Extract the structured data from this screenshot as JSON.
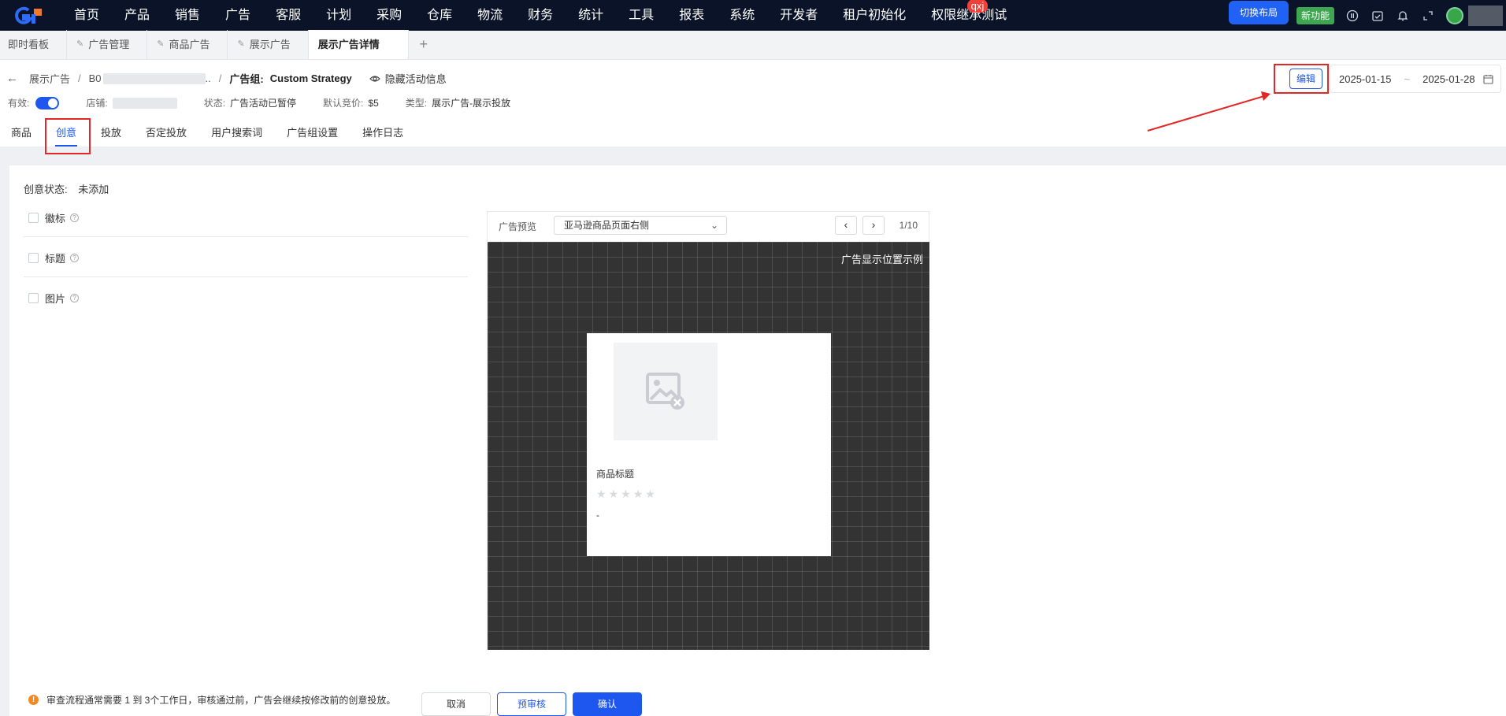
{
  "nav": {
    "items": [
      "首页",
      "产品",
      "销售",
      "广告",
      "客服",
      "计划",
      "采购",
      "仓库",
      "物流",
      "财务",
      "统计",
      "工具",
      "报表",
      "系统",
      "开发者",
      "租户初始化",
      "权限继承测试"
    ],
    "badge": "qxj",
    "switch_layout": "切换布局",
    "new_feature": "新功能"
  },
  "tabs": {
    "items": [
      "即时看板",
      "广告管理",
      "商品广告",
      "展示广告",
      "展示广告详情"
    ],
    "add": "+"
  },
  "header": {
    "crumb_root": "展示广告",
    "crumb_asin": "B0",
    "crumb_asin_suffix": "..",
    "group_label": "广告组:",
    "group_name": "Custom Strategy",
    "hide_info": "隐藏活动信息",
    "edit": "编辑",
    "date_start": "2025-01-15",
    "date_end": "2025-01-28",
    "date_sep": "~"
  },
  "meta": {
    "enabled_label": "有效:",
    "enabled": true,
    "store_label": "店铺:",
    "status_label": "状态:",
    "status_value": "广告活动已暂停",
    "bid_label": "默认竞价:",
    "bid_value": "$5",
    "type_label": "类型:",
    "type_value": "展示广告-展示投放"
  },
  "subtabs": [
    "商品",
    "创意",
    "投放",
    "否定投放",
    "用户搜索词",
    "广告组设置",
    "操作日志"
  ],
  "creative": {
    "status_label": "创意状态:",
    "status_value": "未添加",
    "options": [
      "徽标",
      "标题",
      "图片"
    ]
  },
  "preview": {
    "label": "广告预览",
    "select_value": "亚马逊商品页面右侧",
    "prev": "‹",
    "next": "›",
    "page": "1/10",
    "stage_label": "广告显示位置示例",
    "card_title": "商品标题",
    "card_price": "-"
  },
  "footer": {
    "notice": "审查流程通常需要 1 到 3个工作日，审核通过前，广告会继续按修改前的创意投放。",
    "cancel": "取消",
    "pre_review": "预审核",
    "confirm": "确认"
  },
  "colors": {
    "nav_bg": "#0a1327",
    "primary": "#1e57f0",
    "highlight": "#e32626",
    "stage_bg": "#333333"
  }
}
